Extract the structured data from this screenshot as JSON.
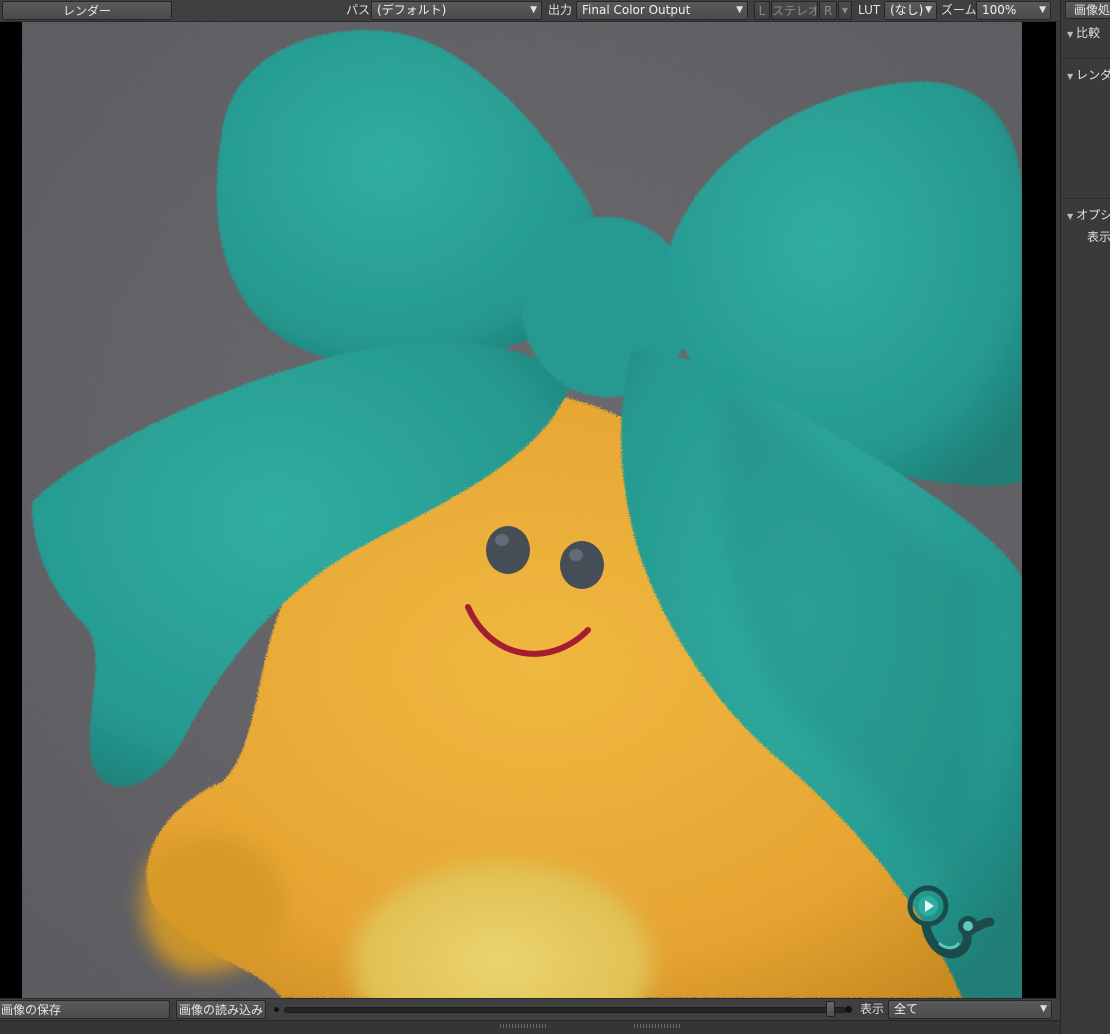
{
  "toolbar": {
    "render_button": "レンダー",
    "path_label": "パス",
    "path_value": "(デフォルト)",
    "output_label": "出力",
    "output_value": "Final Color Output",
    "left_eye": "L",
    "stereo": "ステレオ",
    "right_eye": "R",
    "lut_label": "LUT",
    "lut_value": "(なし)",
    "zoom_label": "ズーム",
    "zoom_value": "100%"
  },
  "right_panel": {
    "tab": "画像処理",
    "sections": [
      {
        "label": "比較"
      },
      {
        "label": "レンダー"
      },
      {
        "label": "オプション",
        "items": [
          "表示"
        ]
      }
    ]
  },
  "bottom": {
    "save_image": "画像の保存",
    "load_image": "画像の読み込み",
    "display_label": "表示",
    "display_value": "全て",
    "slider_position": 0.98
  },
  "render_image": {
    "background": "#5e5e62",
    "ribbon_color": "#1f9c93",
    "body_color": "#e9a82a",
    "belly_color": "#e8cf5e",
    "eye_color": "#3e4650",
    "mouth_color": "#a3122a",
    "logo_icon": "creature-logo-icon"
  },
  "colors": {
    "toolbar_bg": "#3f3f3f",
    "panel_bg": "#3a3a3a",
    "viewport_frame": "#000000"
  }
}
